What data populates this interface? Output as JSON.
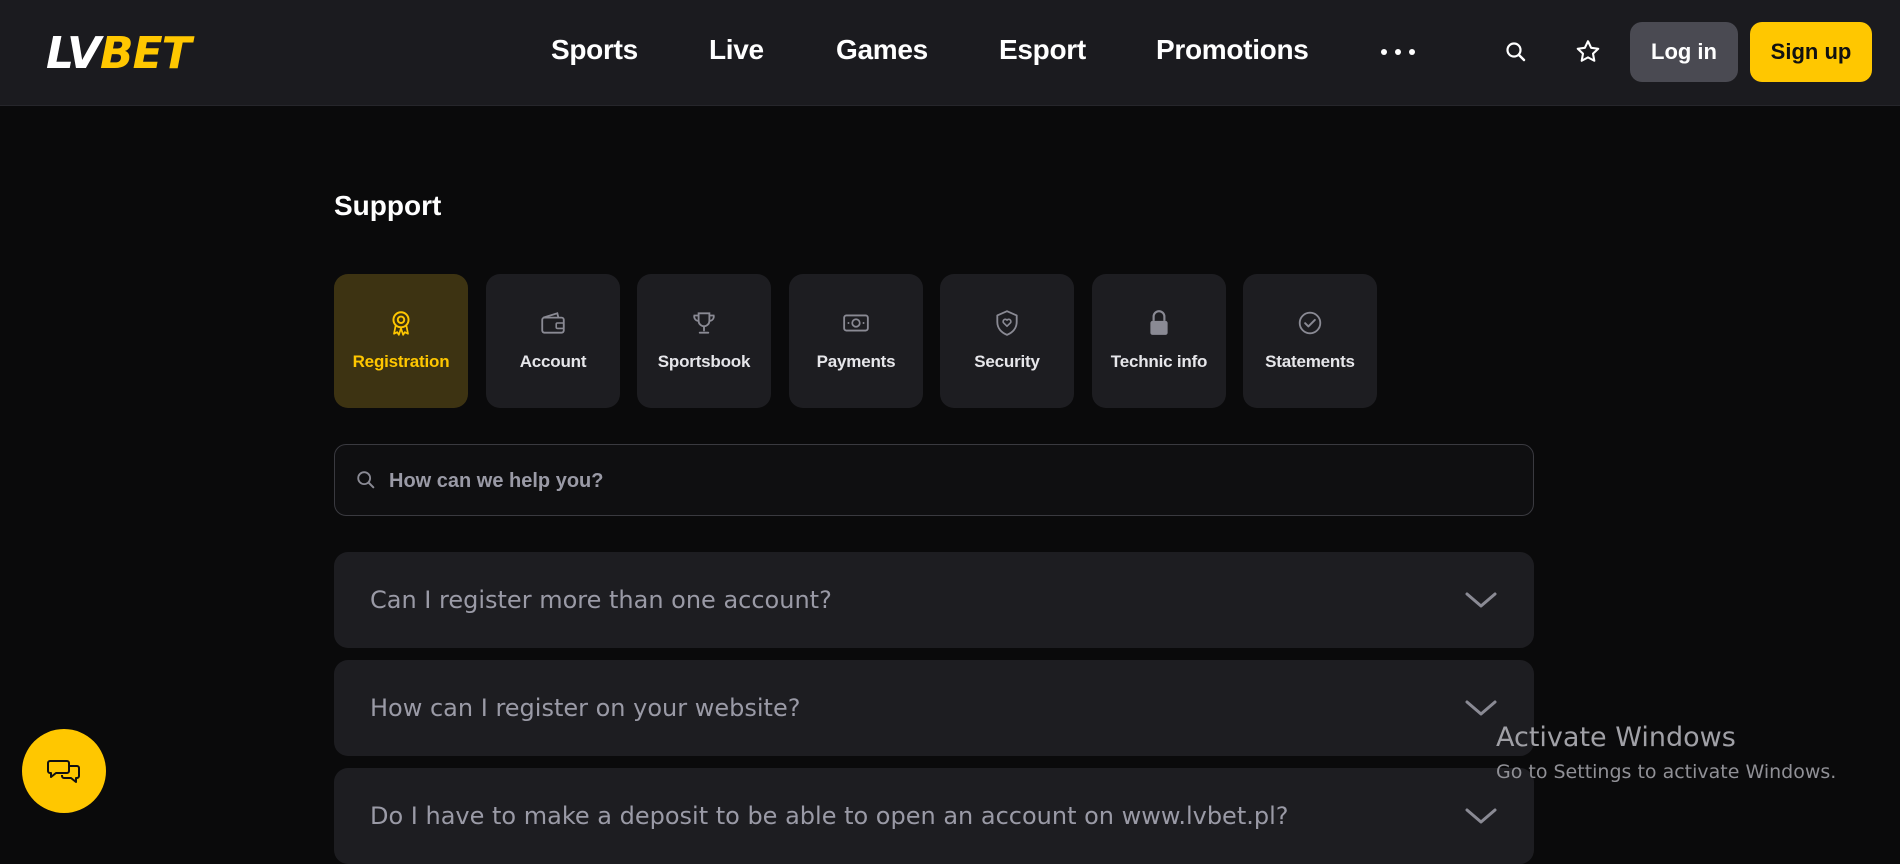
{
  "header": {
    "logo_left": "LV",
    "logo_right": "BET",
    "nav": [
      "Sports",
      "Live",
      "Games",
      "Esport",
      "Promotions"
    ],
    "login_label": "Log in",
    "signup_label": "Sign up"
  },
  "page": {
    "title": "Support"
  },
  "categories": [
    {
      "label": "Registration",
      "icon": "badge-icon",
      "active": true
    },
    {
      "label": "Account",
      "icon": "wallet-icon"
    },
    {
      "label": "Sportsbook",
      "icon": "trophy-icon"
    },
    {
      "label": "Payments",
      "icon": "money-icon"
    },
    {
      "label": "Security",
      "icon": "shield-icon"
    },
    {
      "label": "Technic info",
      "icon": "lock-icon"
    },
    {
      "label": "Statements",
      "icon": "check-circle-icon"
    }
  ],
  "search": {
    "placeholder": "How can we help you?"
  },
  "faq": [
    "Can I register more than one account?",
    "How can I register on your website?",
    "Do I have to make a deposit to be able to open an account on www.lvbet.pl?"
  ],
  "watermark": {
    "title": "Activate Windows",
    "subtitle": "Go to Settings to activate Windows."
  },
  "colors": {
    "accent": "#ffc700",
    "header_bg": "#1b1b1f",
    "card_bg": "#1d1d21"
  }
}
